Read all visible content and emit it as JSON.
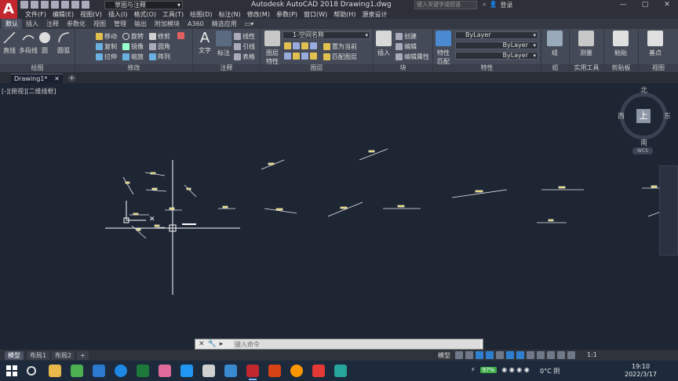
{
  "titlebar": {
    "app_icon": "A",
    "workspace": "草图与注释",
    "title": "Autodesk AutoCAD 2018    Drawing1.dwg",
    "search_placeholder": "键入关键字或短语",
    "login": "登录",
    "controls": [
      "—",
      "▢",
      "✕"
    ]
  },
  "menubar": [
    "文件(F)",
    "编辑(E)",
    "视图(V)",
    "插入(I)",
    "格式(O)",
    "工具(T)",
    "绘图(D)",
    "标注(N)",
    "修改(M)",
    "参数(P)",
    "窗口(W)",
    "帮助(H)",
    "源泉设计"
  ],
  "ribbon_tabs": [
    "默认",
    "插入",
    "注释",
    "参数化",
    "视图",
    "管理",
    "输出",
    "附加模块",
    "A360",
    "精选应用"
  ],
  "ribbon_tab_active": 0,
  "panels": {
    "draw": {
      "title": "绘图",
      "tools": [
        "直线",
        "多段线",
        "圆",
        "圆弧"
      ]
    },
    "modify": {
      "title": "修改",
      "tools": [
        "移动",
        "旋转",
        "修剪",
        "复制",
        "镜像",
        "圆角",
        "拉伸",
        "缩放",
        "阵列"
      ]
    },
    "annotation": {
      "title": "注释",
      "tools": [
        "文字",
        "标注",
        "线性",
        "引线",
        "表格"
      ]
    },
    "layers": {
      "title": "图层",
      "tools": [
        "图层特性",
        "置为当前",
        "匹配图层"
      ],
      "current_layer": "1-空间名称"
    },
    "block": {
      "title": "块",
      "tools": [
        "插入",
        "创建",
        "编辑",
        "编辑属性"
      ]
    },
    "properties": {
      "title": "特性",
      "match": "特性匹配",
      "color": "ByLayer",
      "linetype": "ByLayer",
      "lineweight": "ByLayer"
    },
    "groups": {
      "title": "组",
      "tools": [
        "组"
      ]
    },
    "utilities": {
      "title": "实用工具",
      "tools": [
        "测量"
      ]
    },
    "clipboard": {
      "title": "剪贴板",
      "tools": [
        "粘贴"
      ]
    },
    "view": {
      "title": "视图",
      "tools": [
        "基点"
      ]
    }
  },
  "filetabs": {
    "active": "Drawing1*",
    "close": "✕",
    "add": "+"
  },
  "viewport": {
    "label": "[-][俯视][二维线框]",
    "viewcube": {
      "face": "上",
      "north": "北",
      "south": "南",
      "east": "东",
      "west": "西"
    },
    "wcs": "WCS"
  },
  "command": {
    "placeholder": "键入命令",
    "buttons": [
      "✕",
      "🔧",
      "▸"
    ]
  },
  "layout_tabs": [
    "模型",
    "布局1",
    "布局2",
    "+"
  ],
  "layout_tab_active": 0,
  "status": {
    "mode": "模型",
    "scale": "1:1"
  },
  "taskbar": {
    "battery": "97%",
    "weather": "0°C 阴",
    "time": "19:10",
    "date": "2022/3/17"
  },
  "colors": {
    "canvas": "#1e2533",
    "crosshair": "#ffffff",
    "dimension": "#e8e8e8",
    "dim_text": "#e8d630",
    "autocad_red": "#c1272d"
  }
}
